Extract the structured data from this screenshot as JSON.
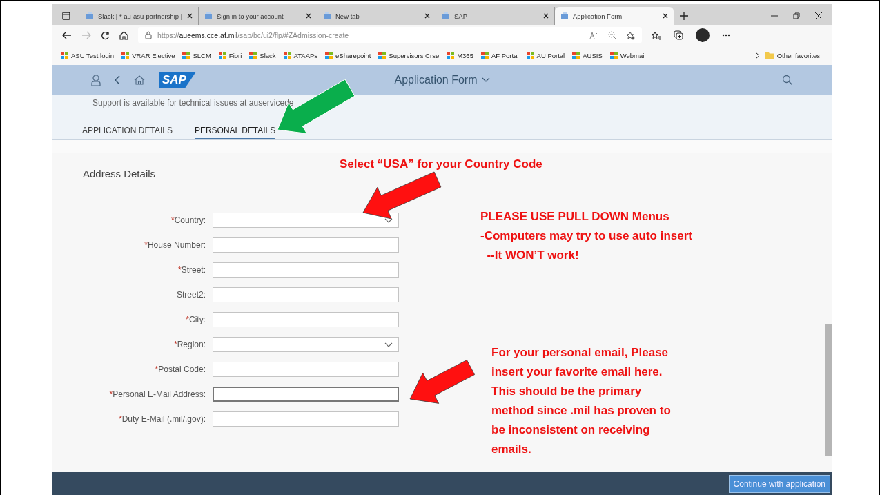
{
  "browser": {
    "tabs": [
      {
        "title": "Slack | * au-asu-partnership |",
        "selected": false
      },
      {
        "title": "Sign in to your account",
        "selected": false
      },
      {
        "title": "New tab",
        "selected": false
      },
      {
        "title": "SAP",
        "selected": false
      },
      {
        "title": "Application Form",
        "selected": true
      }
    ],
    "address": "https://**aueems.cce.af.mil**/sap/bc/ui2/flp/#ZAdmission-create",
    "favorites": [
      "ASU Test login",
      "VRAR Elective",
      "SLCM",
      "Fiori",
      "Slack",
      "ATAAPs",
      "eSharepoint",
      "Supervisors Crse",
      "M365",
      "AF Portal",
      "AU Portal",
      "AUSIS",
      "Webmail"
    ],
    "other_favorites": "Other favorites"
  },
  "sap": {
    "logo": "SAP",
    "title": "Application Form",
    "support_text": "Support is available for technical issues at auservicede",
    "tabs": [
      {
        "label": "APPLICATION DETAILS",
        "selected": false
      },
      {
        "label": "PERSONAL DETAILS",
        "selected": true
      }
    ],
    "section_title": "Address Details",
    "fields": [
      {
        "mark": "*",
        "label": "Country:",
        "kind": "select",
        "focused": false
      },
      {
        "mark": "*",
        "label": "House Number:",
        "kind": "text",
        "focused": false
      },
      {
        "mark": "*",
        "label": "Street:",
        "kind": "text",
        "focused": false
      },
      {
        "label": "Street2:",
        "kind": "text",
        "focused": false
      },
      {
        "mark": "*",
        "label": "City:",
        "kind": "text",
        "focused": false
      },
      {
        "mark": "*",
        "label": "Region:",
        "kind": "select",
        "focused": false
      },
      {
        "mark": "*",
        "label": "Postal Code:",
        "kind": "text",
        "focused": false
      },
      {
        "mark": "*",
        "label": "Personal E-Mail Address:",
        "kind": "text",
        "focused": true
      },
      {
        "mark": "*",
        "label": "Duty E-Mail (.mil/.gov):",
        "kind": "text",
        "focused": false
      }
    ],
    "footer_button": "Continue with application"
  },
  "annotations": [
    {
      "lines": [
        "Select “USA” for your Country Code"
      ]
    },
    {
      "lines": [
        "PLEASE USE PULL DOWN Menus",
        "-Computers may try to use auto insert",
        "  --It WON’T work!"
      ]
    },
    {
      "lines": [
        "For your personal email, Please",
        "insert your favorite email here.",
        "This should be the primary",
        "method since .mil has proven to",
        "be inconsistent on receiving",
        "emails."
      ]
    }
  ]
}
